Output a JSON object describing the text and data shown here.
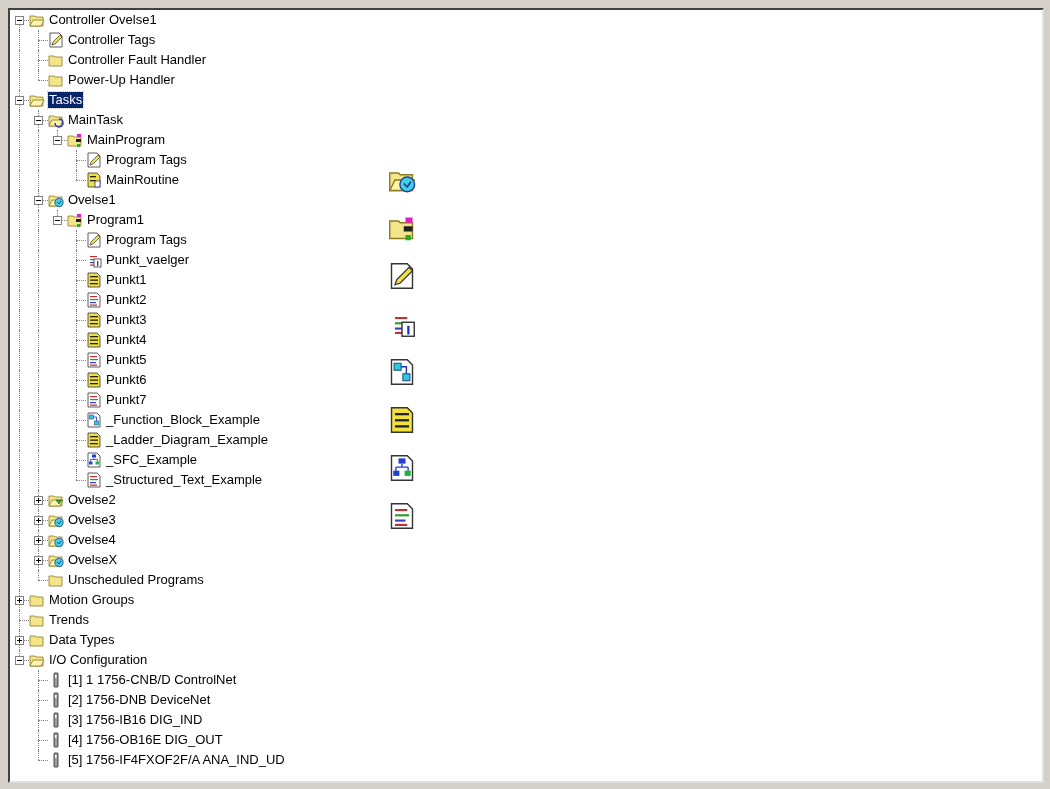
{
  "tree": [
    {
      "label": "Controller Ovelse1",
      "kind": "folder-open",
      "expanded": true,
      "selected": false,
      "children": [
        {
          "label": "Controller Tags",
          "kind": "tags",
          "selected": false
        },
        {
          "label": "Controller Fault Handler",
          "kind": "folder",
          "selected": false
        },
        {
          "label": "Power-Up Handler",
          "kind": "folder",
          "selected": false
        }
      ]
    },
    {
      "label": "Tasks",
      "kind": "folder-open",
      "expanded": true,
      "selected": true,
      "children": [
        {
          "label": "MainTask",
          "kind": "task-continuous",
          "expanded": true,
          "selected": false,
          "children": [
            {
              "label": "MainProgram",
              "kind": "program",
              "expanded": true,
              "selected": false,
              "children": [
                {
                  "label": "Program Tags",
                  "kind": "tags",
                  "selected": false
                },
                {
                  "label": "MainRoutine",
                  "kind": "main-routine",
                  "selected": false
                }
              ]
            }
          ]
        },
        {
          "label": "Ovelse1",
          "kind": "task-periodic",
          "expanded": true,
          "selected": false,
          "children": [
            {
              "label": "Program1",
              "kind": "program",
              "expanded": true,
              "selected": false,
              "children": [
                {
                  "label": "Program Tags",
                  "kind": "tags",
                  "selected": false
                },
                {
                  "label": "Punkt_vaelger",
                  "kind": "sub-routine",
                  "selected": false
                },
                {
                  "label": "Punkt1",
                  "kind": "ladder",
                  "selected": false
                },
                {
                  "label": "Punkt2",
                  "kind": "st",
                  "selected": false
                },
                {
                  "label": "Punkt3",
                  "kind": "ladder",
                  "selected": false
                },
                {
                  "label": "Punkt4",
                  "kind": "ladder",
                  "selected": false
                },
                {
                  "label": "Punkt5",
                  "kind": "st",
                  "selected": false
                },
                {
                  "label": "Punkt6",
                  "kind": "ladder",
                  "selected": false
                },
                {
                  "label": "Punkt7",
                  "kind": "st",
                  "selected": false
                },
                {
                  "label": "_Function_Block_Example",
                  "kind": "fbd",
                  "selected": false
                },
                {
                  "label": "_Ladder_Diagram_Example",
                  "kind": "ladder",
                  "selected": false
                },
                {
                  "label": "_SFC_Example",
                  "kind": "sfc",
                  "selected": false
                },
                {
                  "label": "_Structured_Text_Example",
                  "kind": "st",
                  "selected": false
                }
              ]
            }
          ]
        },
        {
          "label": "Ovelse2",
          "kind": "task-event",
          "expanded": false,
          "selected": false
        },
        {
          "label": "Ovelse3",
          "kind": "task-periodic",
          "expanded": false,
          "selected": false
        },
        {
          "label": "Ovelse4",
          "kind": "task-periodic",
          "expanded": false,
          "selected": false
        },
        {
          "label": "OvelseX",
          "kind": "task-periodic",
          "expanded": false,
          "selected": false
        },
        {
          "label": "Unscheduled Programs",
          "kind": "folder",
          "selected": false
        }
      ]
    },
    {
      "label": "Motion Groups",
      "kind": "folder",
      "expanded": false,
      "selected": false
    },
    {
      "label": "Trends",
      "kind": "folder",
      "selected": false
    },
    {
      "label": "Data Types",
      "kind": "folder",
      "expanded": false,
      "selected": false
    },
    {
      "label": "I/O Configuration",
      "kind": "folder-open",
      "expanded": true,
      "selected": false,
      "children": [
        {
          "label": "[1] 1 1756-CNB/D ControlNet",
          "kind": "module",
          "selected": false
        },
        {
          "label": "[2] 1756-DNB DeviceNet",
          "kind": "module",
          "selected": false
        },
        {
          "label": "[3] 1756-IB16 DIG_IND",
          "kind": "module",
          "selected": false
        },
        {
          "label": "[4] 1756-OB16E DIG_OUT",
          "kind": "module",
          "selected": false
        },
        {
          "label": "[5] 1756-IF4FXOF2F/A ANA_IND_UD",
          "kind": "module",
          "selected": false
        }
      ]
    }
  ]
}
